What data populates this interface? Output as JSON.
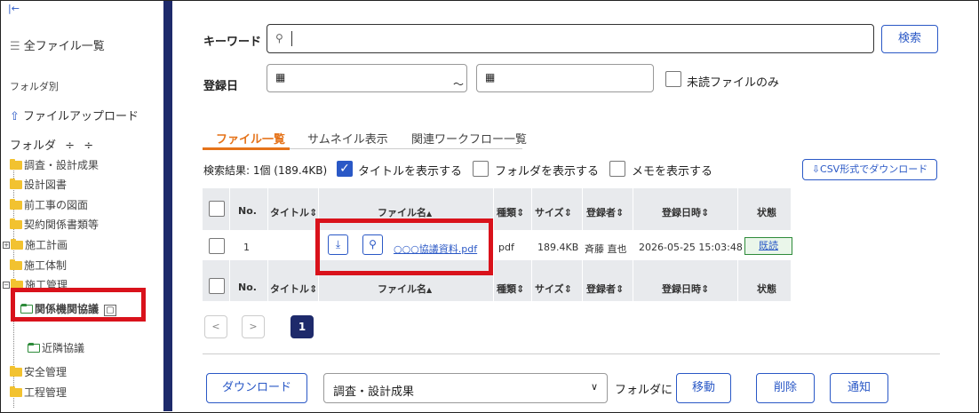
{
  "sidebar": {
    "all_files": "全ファイル一覧",
    "by_folder": "フォルダ別",
    "upload": "ファイルアップロード",
    "folder_header": "フォルダ",
    "folders": [
      "調査・設計成果",
      "設計図書",
      "前工事の図面",
      "契約関係書類等",
      "施工計画",
      "施工体制",
      "施工管理",
      "関係機関協議",
      "近隣協議",
      "安全管理",
      "工程管理"
    ]
  },
  "search": {
    "keyword_label": "キーワード",
    "keyword_value": "",
    "search_button": "検索",
    "date_label": "登録日",
    "date_separator": "～",
    "unread_only": "未読ファイルのみ"
  },
  "tabs": [
    "ファイル一覧",
    "サムネイル表示",
    "関連ワークフロー一覧"
  ],
  "results": {
    "summary": "検索結果: 1個 (189.4KB)",
    "show_title": "タイトルを表示する",
    "show_folder": "フォルダを表示する",
    "show_memo": "メモを表示する",
    "csv_button": "CSV形式でダウンロード"
  },
  "table": {
    "columns": [
      "No.",
      "タイトル",
      "ファイル名",
      "種類",
      "サイズ",
      "登録者",
      "登録日時",
      "状態"
    ],
    "rows": [
      {
        "no": "1",
        "title": "",
        "filename": "○○○協議資料.pdf",
        "type": "pdf",
        "size": "189.4KB",
        "registrant": "斉藤 直也",
        "datetime": "2026-05-25 15:03:48",
        "status": "既読"
      }
    ]
  },
  "pagination": {
    "prev": "<",
    "next": ">",
    "current": "1"
  },
  "bottom": {
    "download": "ダウンロード",
    "folder_select": "調査・設計成果",
    "folder_suffix": "フォルダに",
    "move": "移動",
    "delete": "削除",
    "notify": "通知"
  },
  "icons": {
    "collapse": "collapse-left-icon",
    "list": "list-icon",
    "upload": "upload-icon",
    "sort": "sort-icon",
    "calendar": "calendar-icon",
    "search": "search-icon",
    "download": "download-icon",
    "preview": "magnifier-icon"
  },
  "colors": {
    "accent": "#2a58c6",
    "sidebar_strip": "#1e2a6b",
    "active_tab": "#e5731a",
    "highlight": "#d9121b",
    "folder": "#f2c230"
  }
}
